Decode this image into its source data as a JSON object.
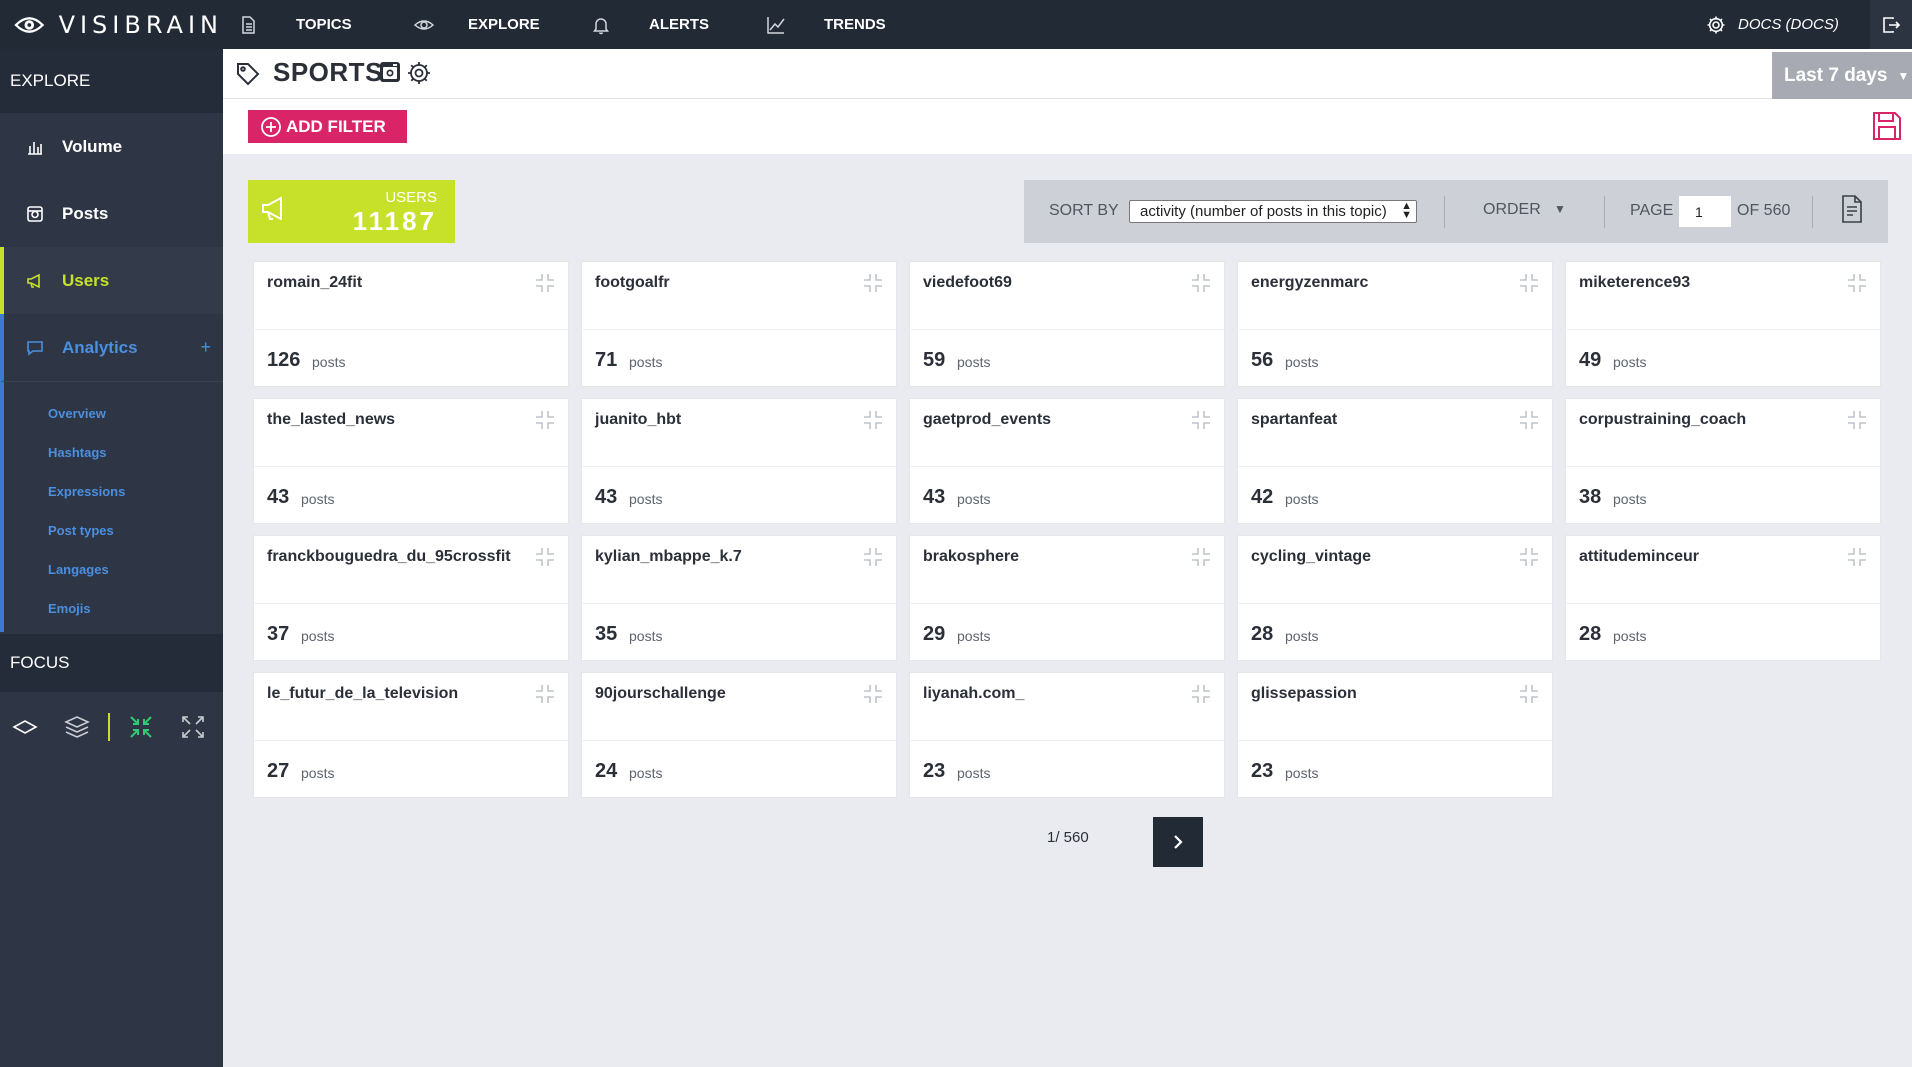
{
  "app": {
    "brand": "VISIBRAIN",
    "accent_color": "#c7e12a",
    "brand_pink": "#da2468",
    "link_blue": "#4a8fe0"
  },
  "topnav": {
    "items": [
      {
        "label": "TOPICS",
        "icon": "document-icon"
      },
      {
        "label": "EXPLORE",
        "icon": "eye-icon"
      },
      {
        "label": "ALERTS",
        "icon": "bell-icon"
      },
      {
        "label": "TRENDS",
        "icon": "line-chart-icon"
      }
    ],
    "docs_label": "DOCS (DOCS)"
  },
  "sidebar": {
    "explore_header": "EXPLORE",
    "items": [
      {
        "label": "Volume",
        "icon": "bar-chart-icon"
      },
      {
        "label": "Posts",
        "icon": "instagram-icon"
      },
      {
        "label": "Users",
        "icon": "megaphone-icon"
      },
      {
        "label": "Analytics",
        "icon": "chat-icon",
        "expand": "+"
      }
    ],
    "analytics_sub": [
      "Overview",
      "Hashtags",
      "Expressions",
      "Post types",
      "Langages",
      "Emojis"
    ],
    "focus_header": "FOCUS"
  },
  "topic": {
    "title": "SPORTS",
    "period": "Last 7 days"
  },
  "filter": {
    "add_label": "ADD FILTER"
  },
  "users_counter": {
    "label": "USERS",
    "count": "11187"
  },
  "sortbar": {
    "sort_label": "SORT BY",
    "sort_value": "activity (number of posts in this topic)",
    "order_label": "ORDER",
    "page_label": "PAGE",
    "page_value": "1",
    "page_of": "OF 560"
  },
  "users": [
    {
      "name": "romain_24fit",
      "count": "126",
      "unit": "posts"
    },
    {
      "name": "footgoalfr",
      "count": "71",
      "unit": "posts"
    },
    {
      "name": "viedefoot69",
      "count": "59",
      "unit": "posts"
    },
    {
      "name": "energyzenmarc",
      "count": "56",
      "unit": "posts"
    },
    {
      "name": "miketerence93",
      "count": "49",
      "unit": "posts"
    },
    {
      "name": "the_lasted_news",
      "count": "43",
      "unit": "posts"
    },
    {
      "name": "juanito_hbt",
      "count": "43",
      "unit": "posts"
    },
    {
      "name": "gaetprod_events",
      "count": "43",
      "unit": "posts"
    },
    {
      "name": "spartanfeat",
      "count": "42",
      "unit": "posts"
    },
    {
      "name": "corpustraining_coach",
      "count": "38",
      "unit": "posts"
    },
    {
      "name": "franckbouguedra_du_95crossfit",
      "count": "37",
      "unit": "posts"
    },
    {
      "name": "kylian_mbappe_k.7",
      "count": "35",
      "unit": "posts"
    },
    {
      "name": "brakosphere",
      "count": "29",
      "unit": "posts"
    },
    {
      "name": "cycling_vintage",
      "count": "28",
      "unit": "posts"
    },
    {
      "name": "attitudeminceur",
      "count": "28",
      "unit": "posts"
    },
    {
      "name": "le_futur_de_la_television",
      "count": "27",
      "unit": "posts"
    },
    {
      "name": "90jourschallenge",
      "count": "24",
      "unit": "posts"
    },
    {
      "name": "liyanah.com_",
      "count": "23",
      "unit": "posts"
    },
    {
      "name": "glissepassion",
      "count": "23",
      "unit": "posts"
    }
  ],
  "pagination": {
    "text": "1/ 560"
  }
}
